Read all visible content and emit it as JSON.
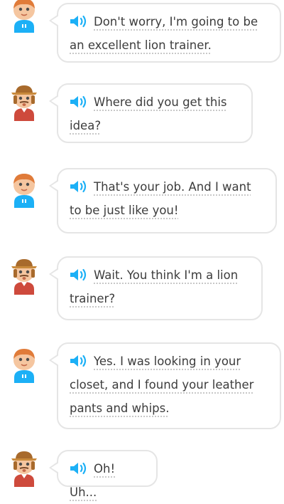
{
  "conversation": {
    "messages": [
      {
        "speaker": "child",
        "text": "Don't worry, I'm going to be an excellent lion trainer."
      },
      {
        "speaker": "adult",
        "text": "Where did you get this idea?"
      },
      {
        "speaker": "child",
        "text": "That's your job. And I want to be just like you!"
      },
      {
        "speaker": "adult",
        "text": "Wait. You think I'm a lion trainer?"
      },
      {
        "speaker": "child",
        "text": "Yes. I was looking in your closet, and I found your leather pants and whips."
      },
      {
        "speaker": "adult",
        "text": "Oh! Uh..."
      }
    ]
  },
  "icons": {
    "audio": "speaker-icon",
    "child_avatar": "child-avatar",
    "adult_avatar": "adult-avatar"
  },
  "colors": {
    "speaker_blue": "#1cb0f6",
    "bubble_border": "#e5e5e5",
    "text": "#3c3c3c"
  }
}
